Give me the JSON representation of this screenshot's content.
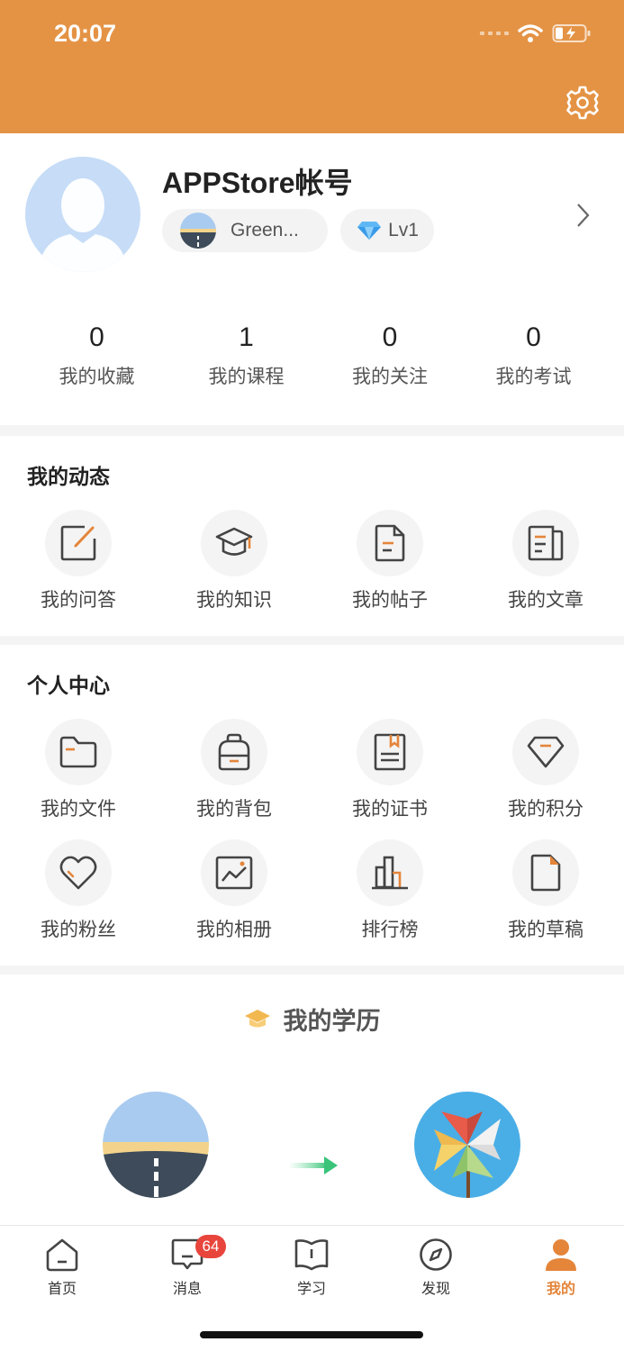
{
  "status": {
    "time": "20:07"
  },
  "colors": {
    "header": "#e49345",
    "accent": "#e4853a",
    "badge": "#e8453c"
  },
  "profile": {
    "username": "APPStore帐号",
    "team_tag": "Green...",
    "level_tag": "Lv1"
  },
  "stats": [
    {
      "value": "0",
      "label": "我的收藏"
    },
    {
      "value": "1",
      "label": "我的课程"
    },
    {
      "value": "0",
      "label": "我的关注"
    },
    {
      "value": "0",
      "label": "我的考试"
    }
  ],
  "dynamics": {
    "title": "我的动态",
    "items": [
      {
        "label": "我的问答",
        "icon": "edit-icon"
      },
      {
        "label": "我的知识",
        "icon": "graduation-cap-icon"
      },
      {
        "label": "我的帖子",
        "icon": "document-icon"
      },
      {
        "label": "我的文章",
        "icon": "article-icon"
      }
    ]
  },
  "center": {
    "title": "个人中心",
    "items": [
      {
        "label": "我的文件",
        "icon": "folder-icon"
      },
      {
        "label": "我的背包",
        "icon": "backpack-icon"
      },
      {
        "label": "我的证书",
        "icon": "certificate-icon"
      },
      {
        "label": "我的积分",
        "icon": "diamond-icon"
      },
      {
        "label": "我的粉丝",
        "icon": "heart-icon"
      },
      {
        "label": "我的相册",
        "icon": "photo-icon"
      },
      {
        "label": "排行榜",
        "icon": "ranking-icon"
      },
      {
        "label": "我的草稿",
        "icon": "draft-icon"
      }
    ]
  },
  "education": {
    "title": "我的学历"
  },
  "tabs": [
    {
      "label": "首页",
      "icon": "home-icon"
    },
    {
      "label": "消息",
      "icon": "message-icon",
      "badge": "64"
    },
    {
      "label": "学习",
      "icon": "book-icon"
    },
    {
      "label": "发现",
      "icon": "compass-icon"
    },
    {
      "label": "我的",
      "icon": "profile-icon",
      "active": true
    }
  ]
}
